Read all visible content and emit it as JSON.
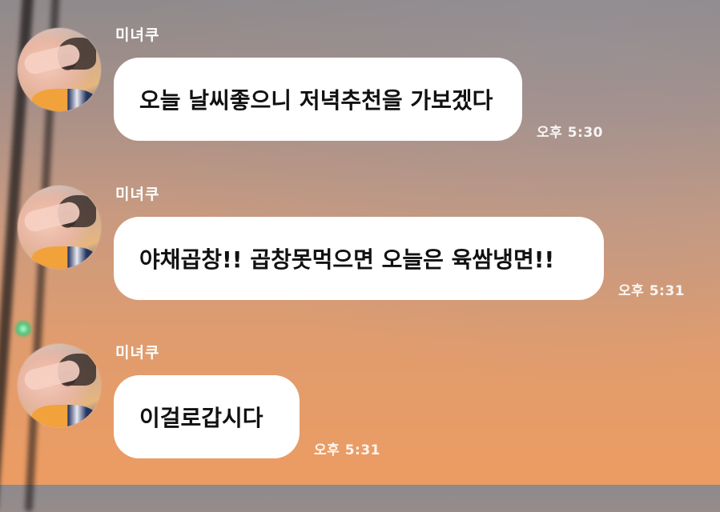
{
  "chat": {
    "messages": [
      {
        "sender": "미녀쿠",
        "text": "오늘 날씨좋으니 저녁추천을 가보겠다",
        "time": "오후 5:30"
      },
      {
        "sender": "미녀쿠",
        "text": "야채곱창!! 곱창못먹으면 오늘은 육쌈냉면!!",
        "time": "오후 5:31"
      },
      {
        "sender": "미녀쿠",
        "text": "이걸로갑시다",
        "time": "오후 5:31"
      }
    ]
  },
  "colors": {
    "bubble": "#ffffff",
    "text": "#111111",
    "sender": "#ffffff",
    "time": "#ffffff"
  }
}
